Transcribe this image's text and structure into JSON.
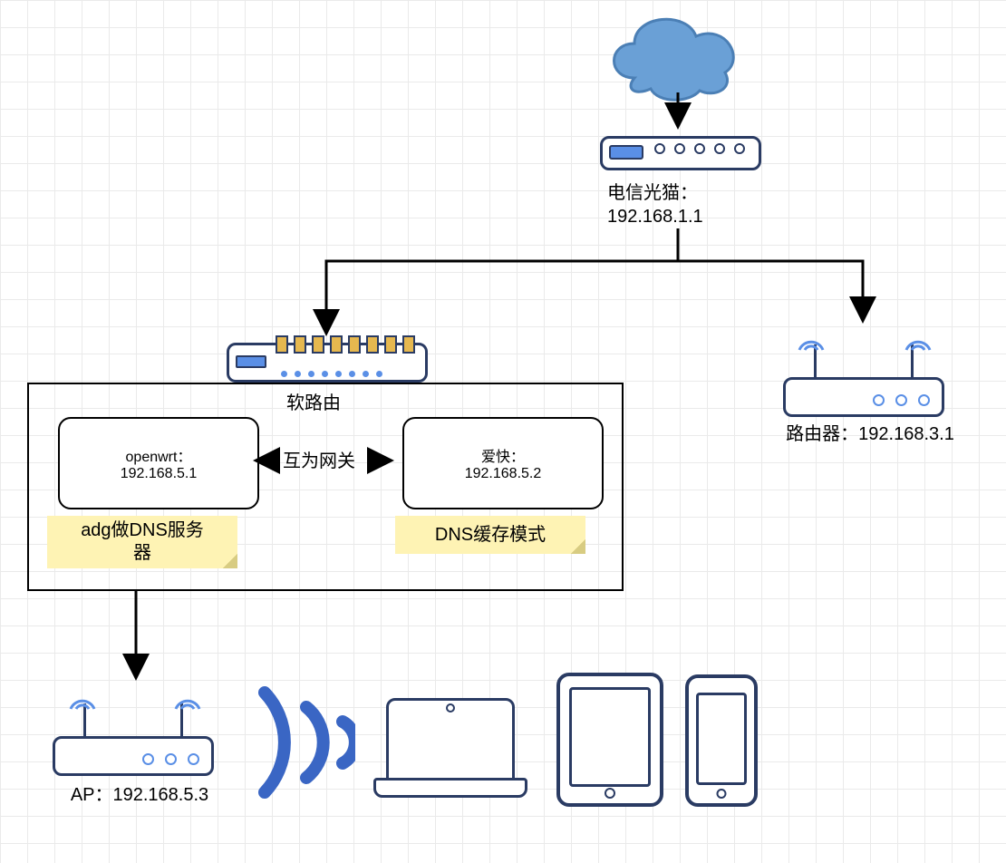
{
  "cloud": {
    "name": "internet-cloud-icon"
  },
  "modem": {
    "label_line1": "电信光猫：",
    "label_line2": "192.168.1.1"
  },
  "soft_router": {
    "title": "软路由"
  },
  "openwrt": {
    "line1": "openwrt：",
    "line2": "192.168.5.1",
    "note": "adg做DNS服务器"
  },
  "gateway_relation": {
    "label": "互为网关"
  },
  "ikuai": {
    "line1": "爱快：",
    "line2": "192.168.5.2",
    "note": "DNS缓存模式"
  },
  "router_right": {
    "label": "路由器：192.168.3.1"
  },
  "ap": {
    "label": "AP：192.168.5.3"
  }
}
